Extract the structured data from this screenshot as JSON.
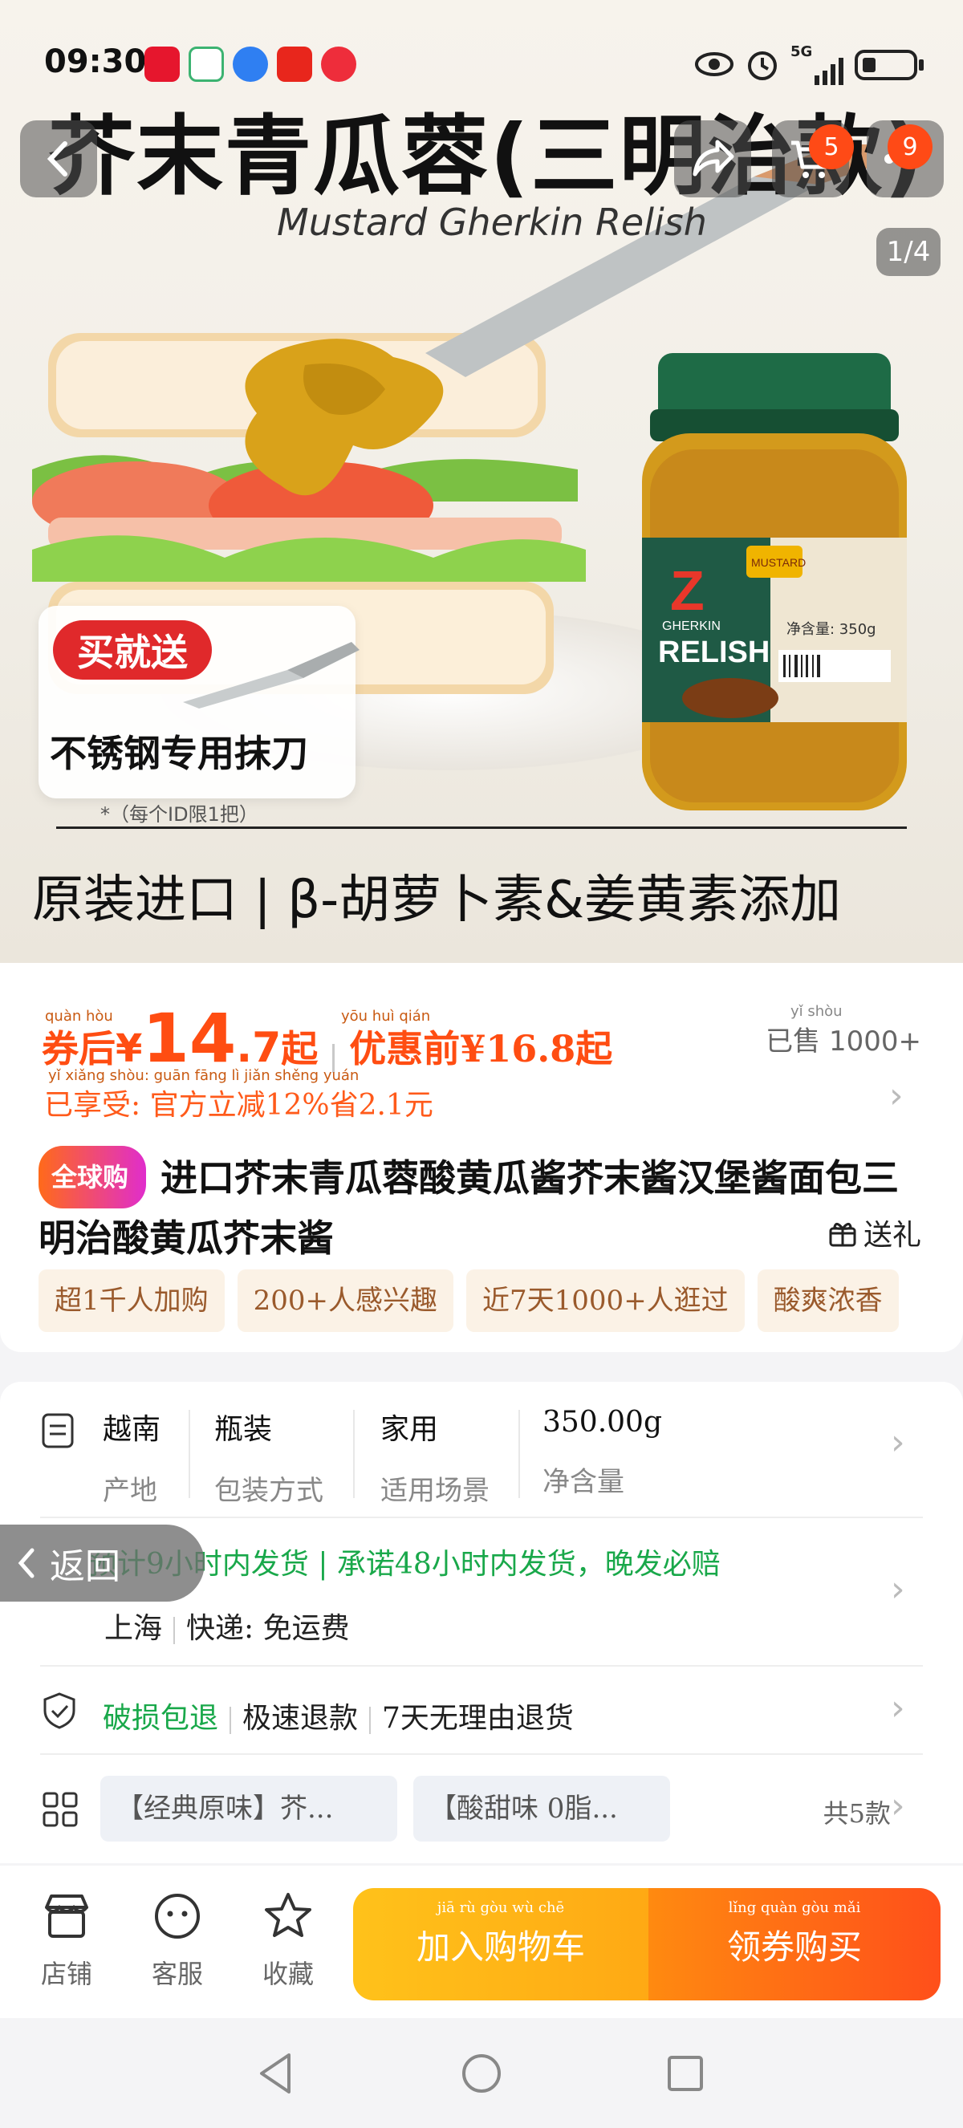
{
  "status_bar": {
    "time": "09:30",
    "network": "5G"
  },
  "hero": {
    "title": "芥末青瓜蓉(三明治款)",
    "subtitle": "Mustard Gherkin Relish",
    "promo_badge": "买就送",
    "promo_text": "不锈钢专用抹刀",
    "promo_note": "*（每个ID限1把）",
    "bottom_text": "原装进口 | β-胡萝卜素&姜黄素添加",
    "jar_brand": "RELISH",
    "jar_small": "GHERKIN",
    "jar_tag": "MUSTARD",
    "jar_net": "净含量: 350g",
    "pager": "1/4",
    "cart_badge": "5",
    "more_badge": "9"
  },
  "price": {
    "coupon_label": "券后",
    "currency": "¥",
    "price_int": "14",
    "price_dec": ".7",
    "price_suffix": "起",
    "pre_label": "优惠前",
    "pre_price": "¥16.8",
    "pre_suffix": "起",
    "sold": "已售 1000+",
    "sold_pinyin": "yǐ shòu",
    "discount": "已享受: 官方立减12%省2.1元",
    "pinyin_price": "quàn hòu",
    "pinyin_pre": "yōu huì qián",
    "pinyin_discount": "yǐ xiǎng shòu:  guān fāng lì jiǎn        shěng      yuán"
  },
  "product": {
    "global_badge": "全球购",
    "title": "进口芥末青瓜蓉酸黄瓜酱芥末酱汉堡酱面包三明治酸黄瓜芥末酱",
    "gift": "送礼"
  },
  "tags": [
    "超1千人加购",
    "200+人感兴趣",
    "近7天1000+人逛过",
    "酸爽浓香"
  ],
  "attributes": [
    {
      "value": "越南",
      "label": "产地"
    },
    {
      "value": "瓶装",
      "label": "包装方式"
    },
    {
      "value": "家用",
      "label": "适用场景"
    },
    {
      "value": "350.00g",
      "label": "净含量"
    }
  ],
  "shipping": {
    "line1": "预计9小时内发货 | 承诺48小时内发货，晚发必赔",
    "location": "上海",
    "express": "快递: 免运费",
    "back_label": "返回"
  },
  "guarantee": {
    "item1": "破损包退",
    "item2": "极速退款",
    "item3": "7天无理由退货"
  },
  "sku": {
    "option1": "【经典原味】芥...",
    "option2": "【酸甜味 0脂...",
    "count": "共5款"
  },
  "actions": {
    "shop": "店铺",
    "service": "客服",
    "favorite": "收藏",
    "add_cart": "加入购物车",
    "buy": "领券购买",
    "pinyin_cart": "jiā  rù  gòu  wù  chē",
    "pinyin_buy": "lǐng  quàn  gòu  mǎi"
  }
}
